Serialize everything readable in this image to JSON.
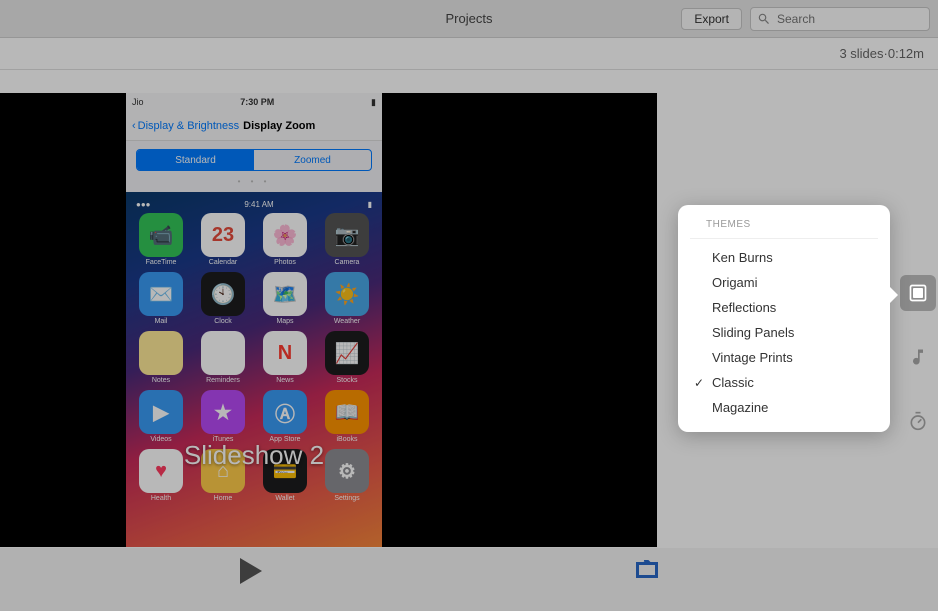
{
  "toolbar": {
    "title": "Projects",
    "export_label": "Export",
    "search_placeholder": "Search"
  },
  "infobar": {
    "slides_count": "3 slides",
    "separator": " · ",
    "duration": "0:12m"
  },
  "phone": {
    "carrier": "Jio",
    "time": "7:30 PM",
    "back_label": "Display & Brightness",
    "nav_title": "Display Zoom",
    "seg_left": "Standard",
    "seg_right": "Zoomed",
    "home_time": "9:41 AM",
    "apps": [
      {
        "label": "FaceTime",
        "bg": "#34c759",
        "glyph": "📹"
      },
      {
        "label": "Calendar",
        "bg": "#ffffff",
        "glyph": "23",
        "text": "#e74c3c"
      },
      {
        "label": "Photos",
        "bg": "#ffffff",
        "glyph": "🌸"
      },
      {
        "label": "Camera",
        "bg": "#555555",
        "glyph": "📷"
      },
      {
        "label": "Mail",
        "bg": "#3a9bf5",
        "glyph": "✉️"
      },
      {
        "label": "Clock",
        "bg": "#1c1c1e",
        "glyph": "🕙"
      },
      {
        "label": "Maps",
        "bg": "#ffffff",
        "glyph": "🗺️"
      },
      {
        "label": "Weather",
        "bg": "#4aa8e8",
        "glyph": "☀️"
      },
      {
        "label": "Notes",
        "bg": "#ffeb99",
        "glyph": ""
      },
      {
        "label": "Reminders",
        "bg": "#ffffff",
        "glyph": ""
      },
      {
        "label": "News",
        "bg": "#ffffff",
        "glyph": "N",
        "text": "#ff3b30"
      },
      {
        "label": "Stocks",
        "bg": "#1c1c1e",
        "glyph": "📈"
      },
      {
        "label": "Videos",
        "bg": "#3a9bf5",
        "glyph": "▶"
      },
      {
        "label": "iTunes",
        "bg": "#b84af5",
        "glyph": "★"
      },
      {
        "label": "App Store",
        "bg": "#3a9bf5",
        "glyph": "Ⓐ"
      },
      {
        "label": "iBooks",
        "bg": "#ff9500",
        "glyph": "📖"
      },
      {
        "label": "Health",
        "bg": "#ffffff",
        "glyph": "♥",
        "text": "#ff3b60"
      },
      {
        "label": "Home",
        "bg": "#ffcc4a",
        "glyph": "⌂"
      },
      {
        "label": "Wallet",
        "bg": "#1c1c1e",
        "glyph": "💳"
      },
      {
        "label": "Settings",
        "bg": "#8e8e93",
        "glyph": "⚙"
      }
    ]
  },
  "slideshow": {
    "title": "Slideshow 2"
  },
  "themes": {
    "header": "THEMES",
    "items": [
      {
        "label": "Ken Burns",
        "selected": false
      },
      {
        "label": "Origami",
        "selected": false
      },
      {
        "label": "Reflections",
        "selected": false
      },
      {
        "label": "Sliding Panels",
        "selected": false
      },
      {
        "label": "Vintage Prints",
        "selected": false
      },
      {
        "label": "Classic",
        "selected": true
      },
      {
        "label": "Magazine",
        "selected": false
      }
    ]
  }
}
